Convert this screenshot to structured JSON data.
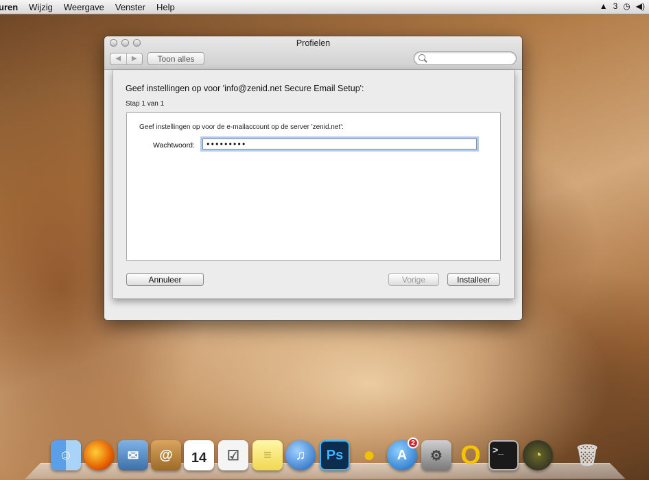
{
  "menubar": {
    "items": [
      "uren",
      "Wijzig",
      "Weergave",
      "Venster",
      "Help"
    ],
    "status_right": "3"
  },
  "window": {
    "title": "Profielen",
    "toolbar": {
      "back_glyph": "◀",
      "forward_glyph": "▶",
      "show_all_label": "Toon alles",
      "search_placeholder": ""
    }
  },
  "sheet": {
    "heading": "Geef instellingen op voor 'info@zenid.net Secure Email Setup':",
    "step": "Stap 1 van 1",
    "description": "Geef instellingen op voor de e-mailaccount op de server 'zenid.net':",
    "password_label": "Wachtwoord:",
    "password_value": "•••••••••",
    "buttons": {
      "cancel": "Annuleer",
      "previous": "Vorige",
      "install": "Installeer"
    }
  },
  "window_footer": {
    "plus": "+",
    "minus": "−",
    "help": "?"
  },
  "dock": {
    "calendar_day": "14",
    "photoshop_label": "Ps",
    "appstore_badge": "2"
  }
}
